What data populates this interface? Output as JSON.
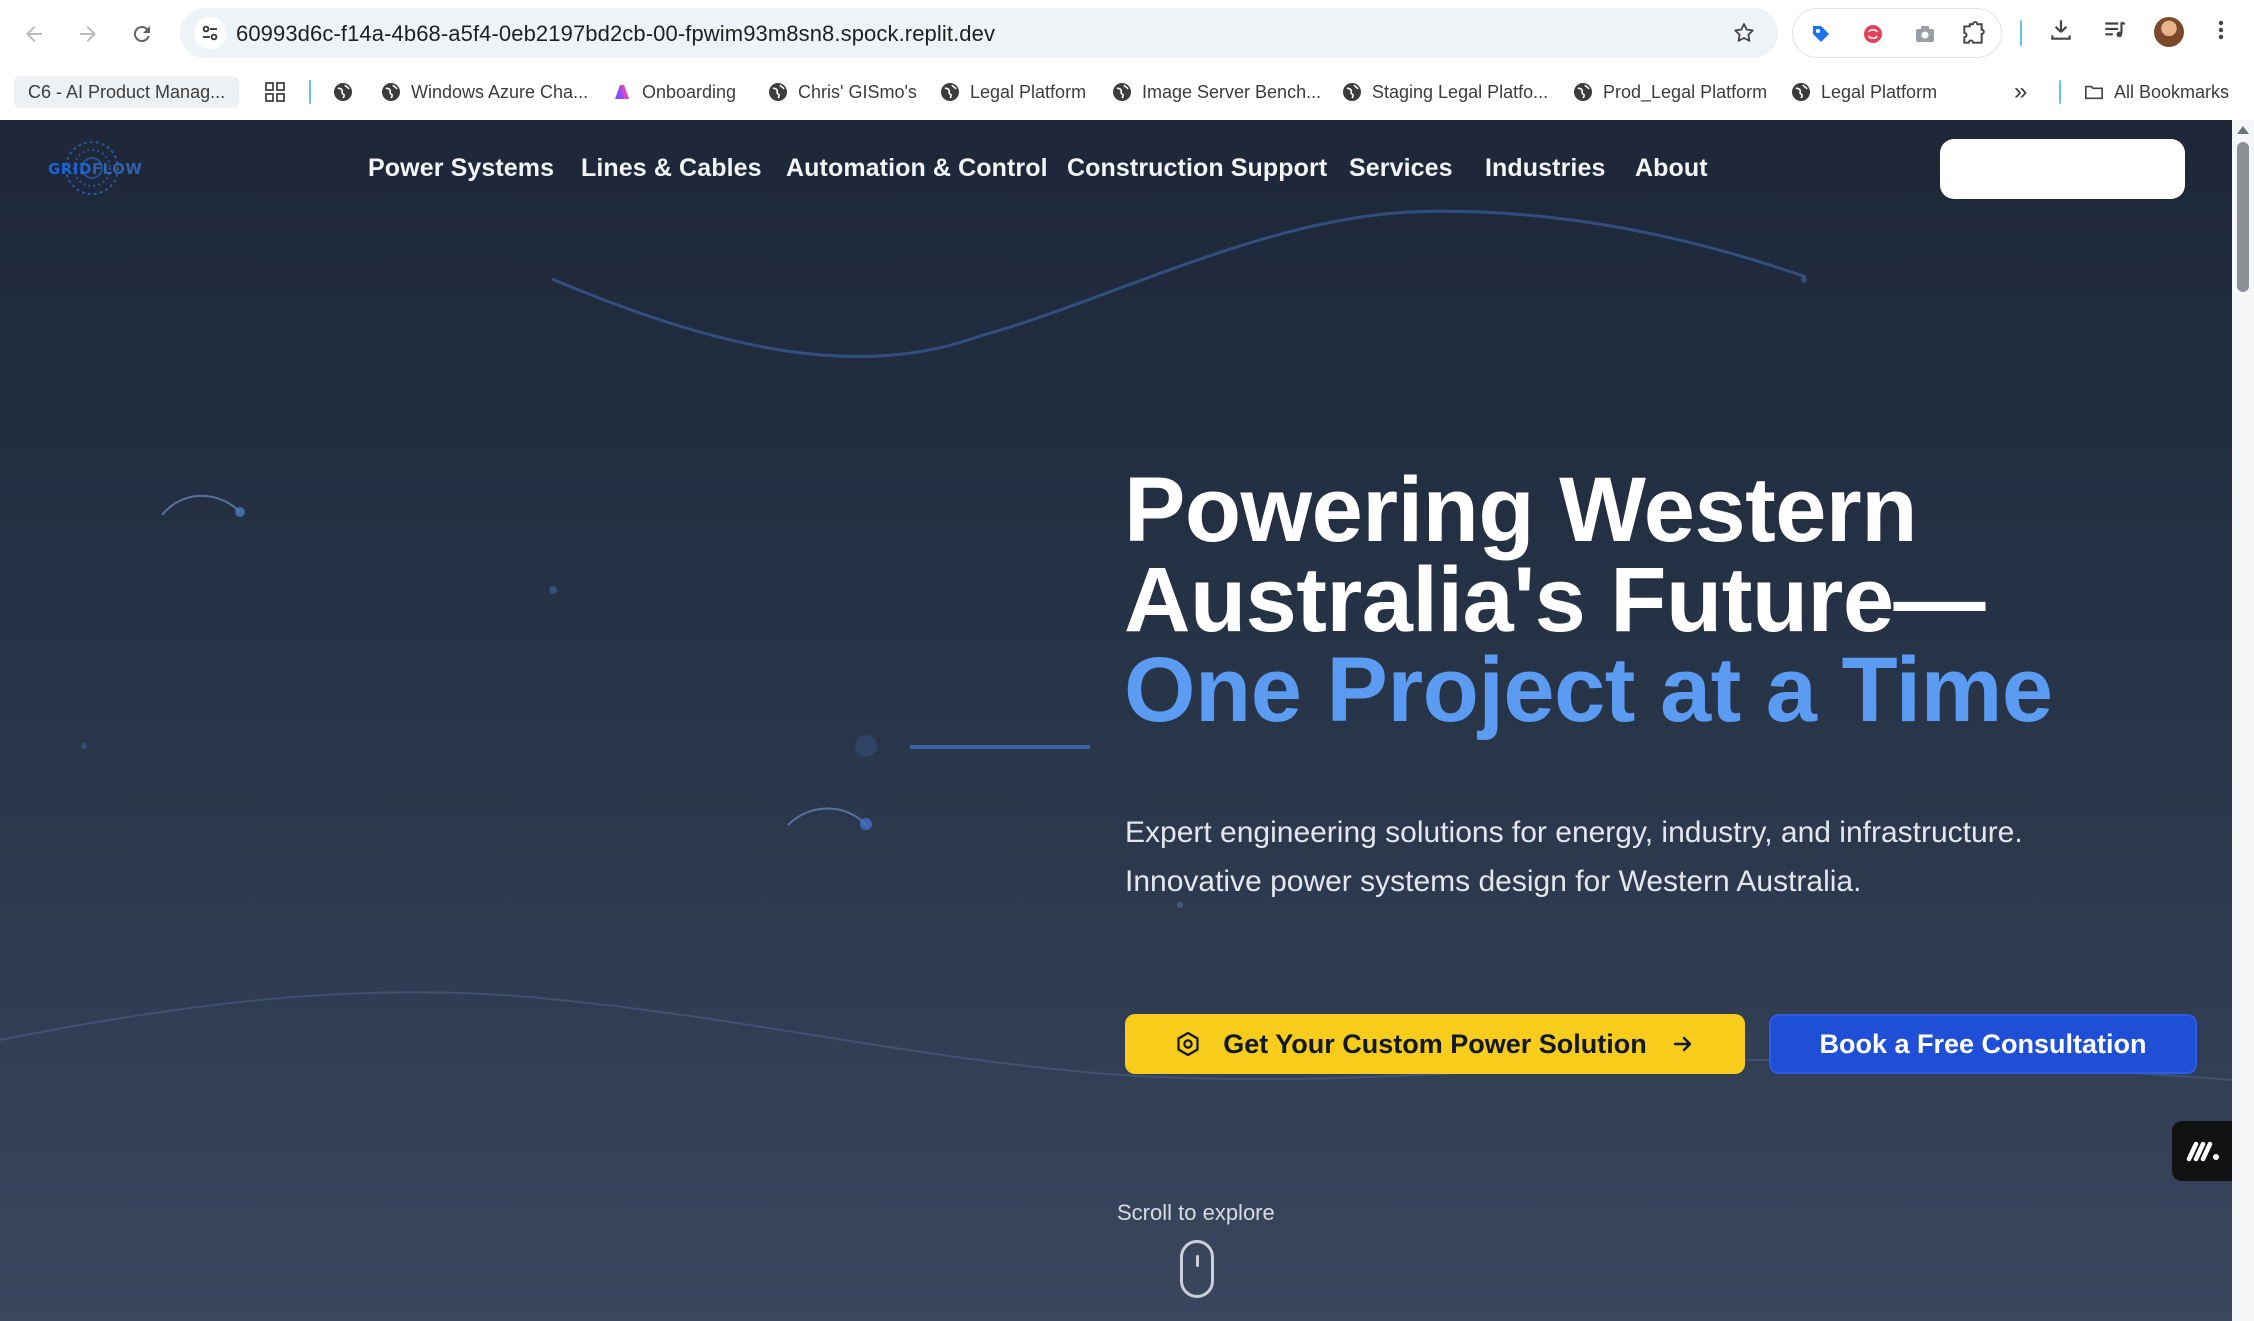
{
  "browser": {
    "url": "60993d6c-f14a-4b68-a5f4-0eb2197bd2cb-00-fpwim93m8sn8.spock.replit.dev",
    "bookmarks": [
      "C6 - AI Product Manag...",
      "Windows Azure Cha...",
      "Onboarding",
      "Chris' GISmo's",
      "Legal Platform",
      "Image Server Bench...",
      "Staging Legal Platfo...",
      "Prod_Legal Platform",
      "Legal Platform"
    ],
    "overflow_label": "»",
    "all_bookmarks": "All Bookmarks",
    "icons": [
      "back-icon",
      "forward-icon",
      "reload-icon",
      "site-info-icon",
      "star-icon",
      "extension-icon",
      "download-icon",
      "media-icon",
      "menu-icon"
    ]
  },
  "site": {
    "logo": {
      "part1": "GRID",
      "part2": "FLOW"
    },
    "nav": [
      "Power Systems",
      "Lines & Cables",
      "Automation & Control",
      "Construction Support",
      "Services",
      "Industries",
      "About"
    ],
    "hero": {
      "title_line1": "Powering Western",
      "title_line2": "Australia's Future—",
      "title_line3": "One Project at a Time",
      "subtitle_line1": "Expert engineering solutions for energy, industry, and infrastructure.",
      "subtitle_line2": "Innovative power systems design for Western Australia."
    },
    "buttons": {
      "primary": "Get Your Custom Power Solution",
      "secondary": "Book a Free Consultation"
    },
    "scroll_label": "Scroll to explore",
    "colors": {
      "accent_blue": "#5b9cf2",
      "primary_yellow": "#f8cc1b",
      "secondary_blue": "#1f4fd7",
      "background": "#243043"
    }
  }
}
